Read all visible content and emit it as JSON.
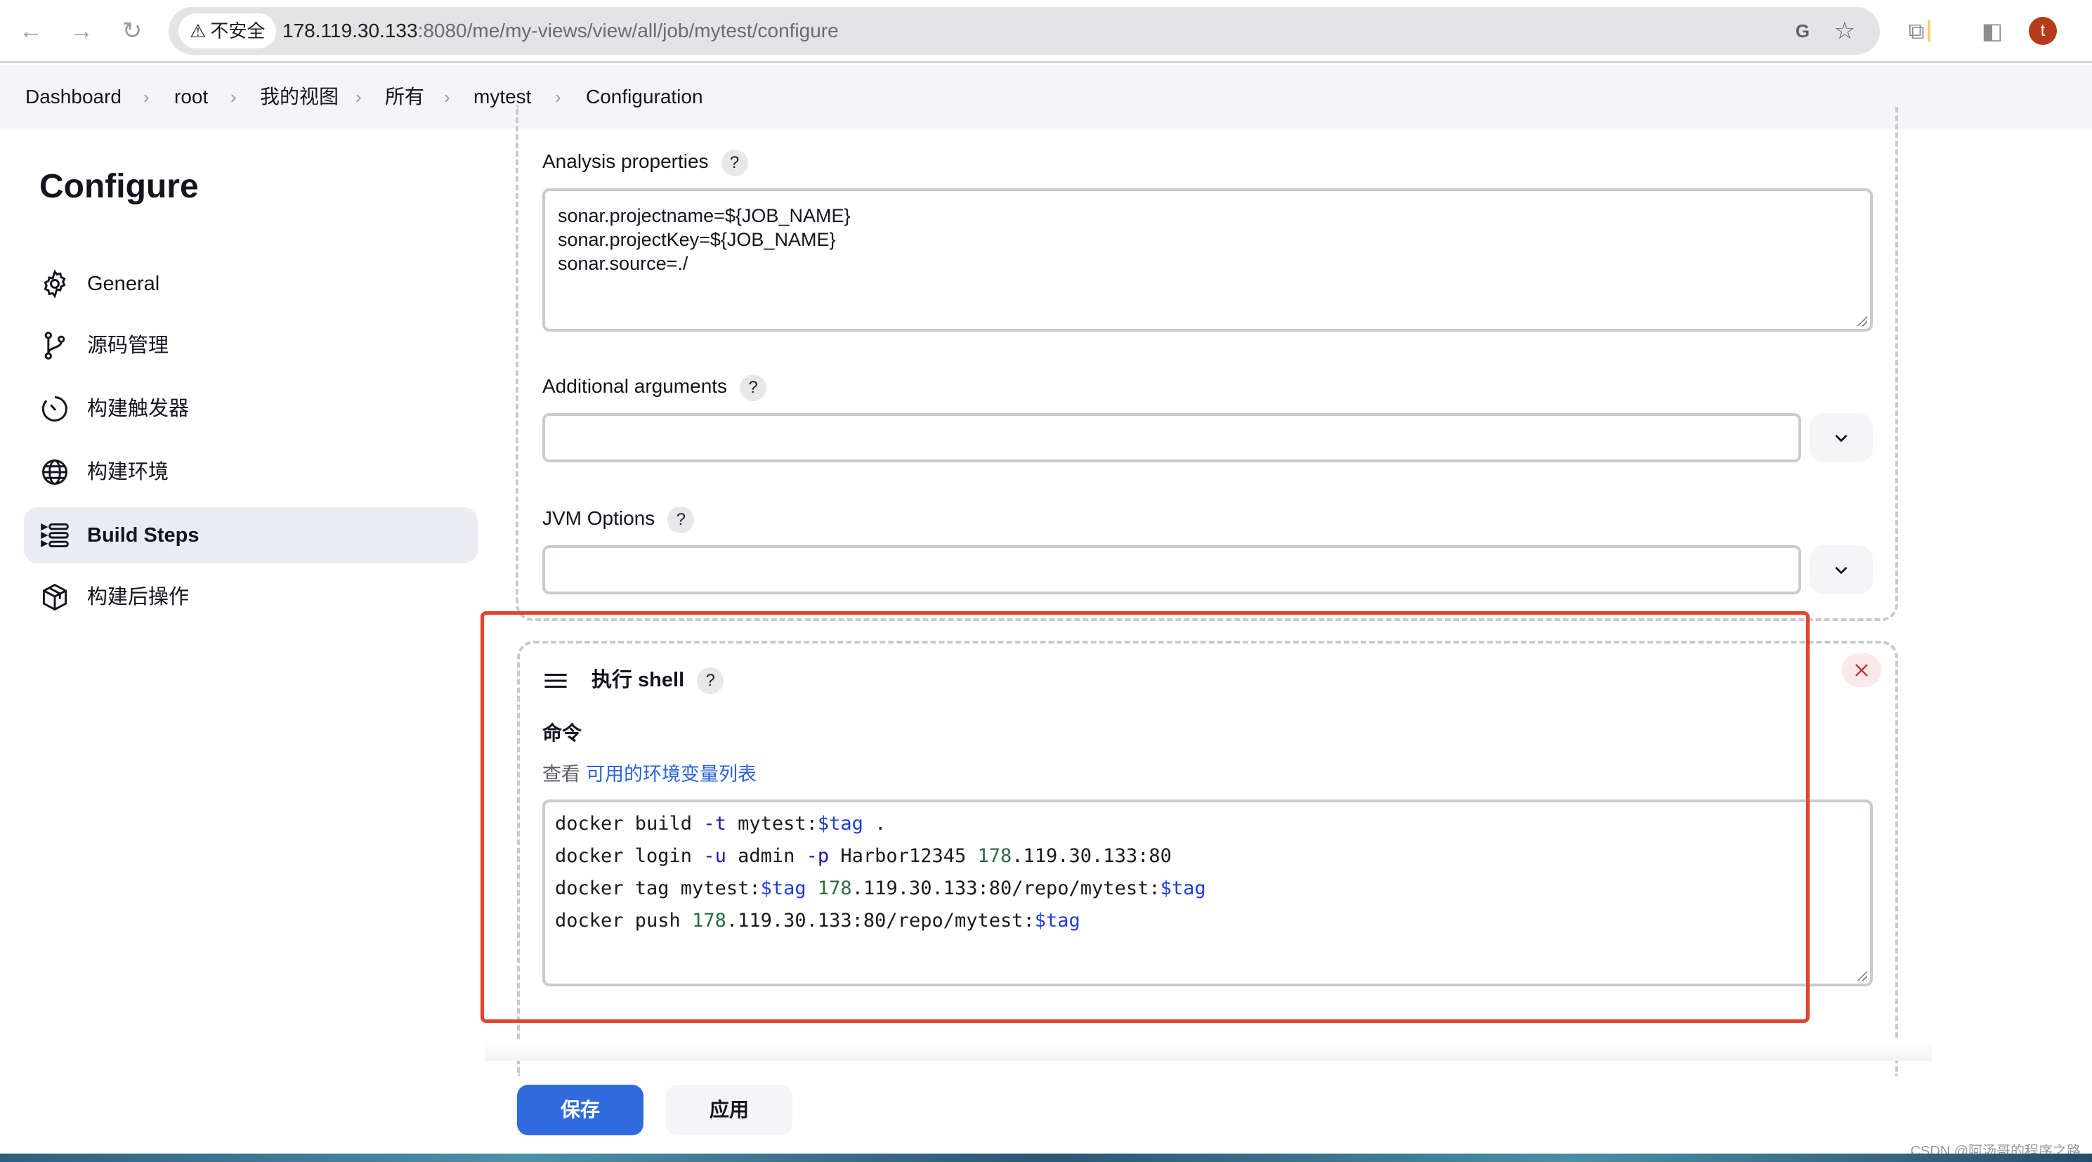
{
  "browser": {
    "security_label": "不安全",
    "url_host": "178.119.30.133",
    "url_rest": ":8080/me/my-views/view/all/job/mytest/configure",
    "avatar_letter": "t",
    "icons": [
      "back-icon",
      "forward-icon",
      "reload-icon",
      "warning-icon",
      "translate-icon",
      "bookmark-star-icon",
      "extensions-icon",
      "side-panel-icon"
    ]
  },
  "breadcrumb": [
    "Dashboard",
    "root",
    "我的视图",
    "所有",
    "mytest",
    "Configuration"
  ],
  "sidebar": {
    "title": "Configure",
    "items": [
      {
        "label": "General",
        "icon": "gear-icon",
        "active": false
      },
      {
        "label": "源码管理",
        "icon": "git-branch-icon",
        "active": false
      },
      {
        "label": "构建触发器",
        "icon": "timer-icon",
        "active": false
      },
      {
        "label": "构建环境",
        "icon": "globe-icon",
        "active": false
      },
      {
        "label": "Build Steps",
        "icon": "list-steps-icon",
        "active": true
      },
      {
        "label": "构建后操作",
        "icon": "package-icon",
        "active": false
      }
    ]
  },
  "sonar_section": {
    "analysis_properties_label": "Analysis properties",
    "analysis_properties_value": "sonar.projectname=${JOB_NAME}\nsonar.projectKey=${JOB_NAME}\nsonar.source=./",
    "additional_arguments_label": "Additional arguments",
    "additional_arguments_value": "",
    "jvm_options_label": "JVM Options",
    "jvm_options_value": "",
    "help_glyph": "?"
  },
  "shell_section": {
    "title": "执行 shell",
    "help_glyph": "?",
    "command_label": "命令",
    "env_prefix": "查看",
    "env_link": "可用的环境变量列表",
    "command_lines": [
      [
        {
          "t": "docker build ",
          "c": ""
        },
        {
          "t": "-t",
          "c": "flag"
        },
        {
          "t": " mytest:",
          "c": ""
        },
        {
          "t": "$tag",
          "c": "var"
        },
        {
          "t": " .",
          "c": ""
        }
      ],
      [
        {
          "t": "docker login ",
          "c": ""
        },
        {
          "t": "-u",
          "c": "flag"
        },
        {
          "t": " admin ",
          "c": ""
        },
        {
          "t": "-p",
          "c": "flag"
        },
        {
          "t": " Harbor12345 ",
          "c": ""
        },
        {
          "t": "178",
          "c": "num"
        },
        {
          "t": ".119.30.133:80",
          "c": ""
        }
      ],
      [
        {
          "t": "docker tag mytest:",
          "c": ""
        },
        {
          "t": "$tag",
          "c": "var"
        },
        {
          "t": " ",
          "c": ""
        },
        {
          "t": "178",
          "c": "num"
        },
        {
          "t": ".119.30.133:80/repo/mytest:",
          "c": ""
        },
        {
          "t": "$tag",
          "c": "var"
        }
      ],
      [
        {
          "t": "docker push ",
          "c": ""
        },
        {
          "t": "178",
          "c": "num"
        },
        {
          "t": ".119.30.133:80/repo/mytest:",
          "c": ""
        },
        {
          "t": "$tag",
          "c": "var"
        }
      ]
    ]
  },
  "footer": {
    "save_label": "保存",
    "apply_label": "应用"
  },
  "watermark": "CSDN @阿汤哥的程序之路",
  "colors": {
    "accent": "#2f6bdd",
    "highlight_border": "#e2432a",
    "link": "#2a64d6"
  }
}
